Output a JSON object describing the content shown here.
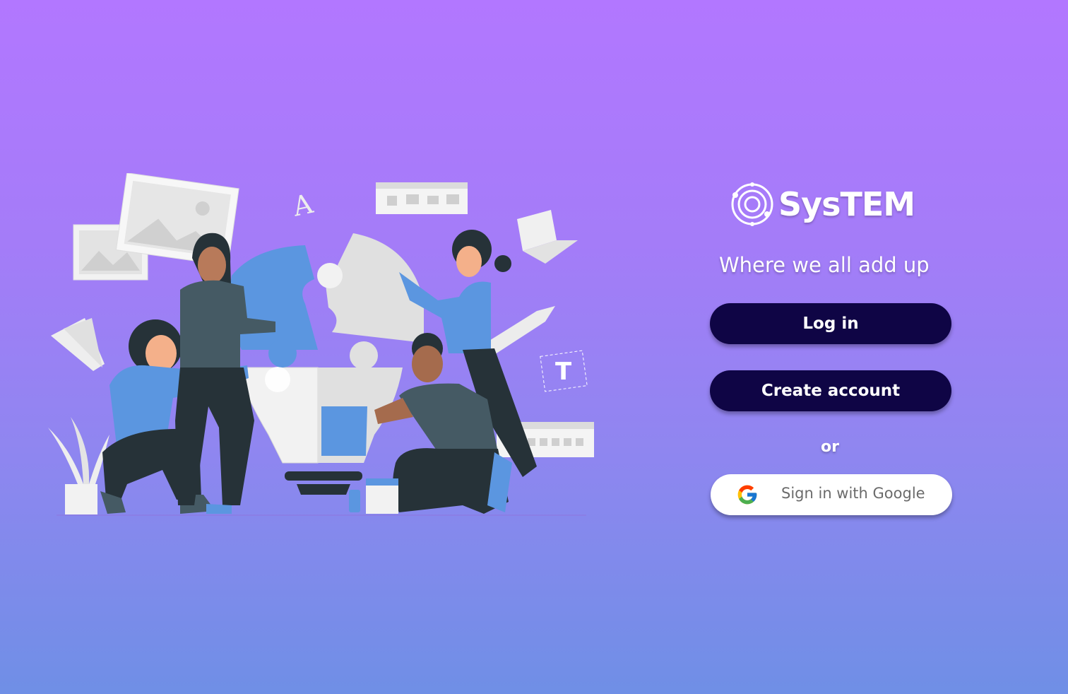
{
  "brand": {
    "name": "SysTEM",
    "tagline": "Where we all add up",
    "logo_icon": "orbit-circles-icon"
  },
  "auth": {
    "login_label": "Log in",
    "create_label": "Create account",
    "or_label": "or",
    "google_label": "Sign in with Google",
    "google_icon": "google-g-icon"
  },
  "colors": {
    "background_top": "#b277ff",
    "background_bottom": "#6f8fe6",
    "button_dark": "#0f0545",
    "accent_blue": "#5b96e0"
  },
  "illustration": {
    "subject": "teamwork-puzzle-lightbulb-illustration"
  }
}
